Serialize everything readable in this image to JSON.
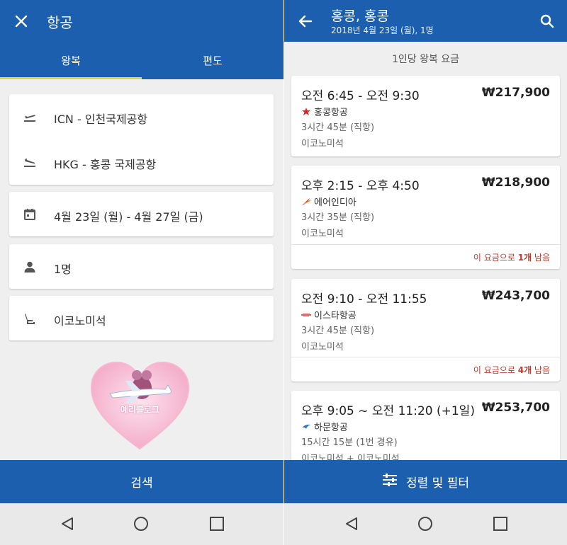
{
  "left": {
    "title": "항공",
    "tabs": [
      {
        "label": "왕복",
        "active": true
      },
      {
        "label": "편도",
        "active": false
      }
    ],
    "origin": "ICN - 인천국제공항",
    "destination": "HKG - 홍콩 국제공항",
    "dates": "4월 23일 (월)  -  4월 27일 (금)",
    "passengers": "1명",
    "cabin": "이코노미석",
    "search_button": "검색",
    "watermark": "예리블로그"
  },
  "right": {
    "title": "홍콩, 홍콩",
    "subtitle": "2018년 4월 23일 (월), 1명",
    "list_header": "1인당 왕복 요금",
    "flights": [
      {
        "time": "오전 6:45 - 오전 9:30",
        "price": "₩217,900",
        "airline": "홍콩항공",
        "duration": "3시간 45분 (직항)",
        "cabin": "이코노미석",
        "seats_prefix": "",
        "seats_count": "",
        "seats_suffix": ""
      },
      {
        "time": "오후 2:15 - 오후 4:50",
        "price": "₩218,900",
        "airline": "에어인디아",
        "duration": "3시간 35분 (직항)",
        "cabin": "이코노미석",
        "seats_prefix": "이 요금으로 ",
        "seats_count": "1개",
        "seats_suffix": " 남음"
      },
      {
        "time": "오전 9:10 - 오전 11:55",
        "price": "₩243,700",
        "airline": "이스타항공",
        "duration": "3시간 45분 (직항)",
        "cabin": "이코노미석",
        "seats_prefix": "이 요금으로 ",
        "seats_count": "4개",
        "seats_suffix": " 남음"
      },
      {
        "time": "오후 9:05 ~ 오전 11:20 (+1일)",
        "price": "₩253,700",
        "airline": "하문항공",
        "duration": "15시간 15분 (1번 경유)",
        "cabin": "이코노미석 + 이코노미석",
        "seats_prefix": "",
        "seats_count": "",
        "seats_suffix": ""
      }
    ],
    "sort_filter_button": "정렬 및 필터"
  },
  "colors": {
    "primary": "#1c5fae",
    "tab_indicator": "#e7d536",
    "background": "#efefef",
    "seats_warning": "#c0392b"
  },
  "icons": [
    "close-icon",
    "takeoff-icon",
    "landing-icon",
    "calendar-icon",
    "person-icon",
    "seat-icon",
    "back-arrow-icon",
    "search-icon",
    "sliders-icon",
    "nav-back-icon",
    "nav-home-icon",
    "nav-recents-icon"
  ]
}
